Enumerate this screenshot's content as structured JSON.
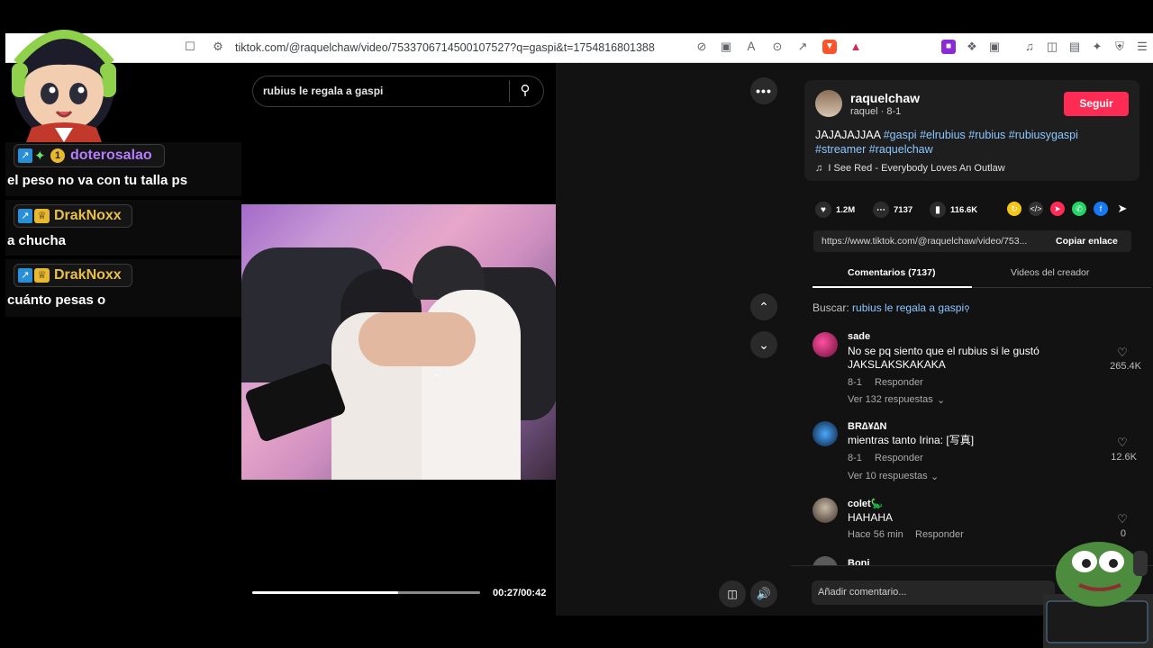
{
  "browser": {
    "url": "tiktok.com/@raquelchaw/video/7533706714500107527?q=gaspi&t=1754816801388"
  },
  "search": {
    "query": "rubius le regala a gaspi"
  },
  "video": {
    "time": "00:27/00:42",
    "progress": 0.64
  },
  "creator": {
    "username": "raquelchaw",
    "subline": "raquel · 8-1",
    "follow_label": "Seguir",
    "caption_text": "JAJAJAJJAA",
    "hashtags": [
      "#gaspi",
      "#elrubius",
      "#rubius",
      "#rubiusygaspi",
      "#streamer",
      "#raquelchaw"
    ],
    "music": "I See Red - Everybody Loves An Outlaw"
  },
  "stats": {
    "likes": "1.2M",
    "comments": "7137",
    "saves": "116.6K"
  },
  "link": {
    "url": "https://www.tiktok.com/@raquelchaw/video/753...",
    "copy_label": "Copiar enlace"
  },
  "tabs": {
    "comments": "Comentarios (7137)",
    "creator_videos": "Videos del creador"
  },
  "buscar": {
    "label": "Buscar:",
    "query": "rubius le regala a gaspi"
  },
  "comments": [
    {
      "name": "sade",
      "text1": "No se pq siento que el rubius si le gustó",
      "text2": "JAKSLAKSKAKAKA",
      "date": "8-1",
      "reply": "Responder",
      "likes": "265.4K",
      "more": "Ver 132 respuestas"
    },
    {
      "name": "BR∆¥∆N",
      "text1": "mientras tanto Irina: [写真]",
      "text2": "",
      "date": "8-1",
      "reply": "Responder",
      "likes": "12.6K",
      "more": "Ver 10 respuestas"
    },
    {
      "name": "colet🦕",
      "text1": "HAHAHA",
      "text2": "",
      "date": "Hace 56 min",
      "reply": "Responder",
      "likes": "0",
      "more": ""
    },
    {
      "name": "Boni",
      "text1": "",
      "text2": "",
      "date": "",
      "reply": "",
      "likes": "",
      "more": ""
    }
  ],
  "comment_input": {
    "placeholder": "Añadir comentario..."
  },
  "chat": [
    {
      "user": "doterosalao",
      "color": "#b77cff",
      "message": "el peso no va con tu talla ps"
    },
    {
      "user": "DrakNoxx",
      "color": "#e8c04a",
      "message": "a chucha"
    },
    {
      "user": "DrakNoxx",
      "color": "#e8c04a",
      "message": "cuánto pesas o"
    }
  ],
  "colors": {
    "accent": "#fe2c55",
    "hashtag": "#8cc8ff"
  }
}
